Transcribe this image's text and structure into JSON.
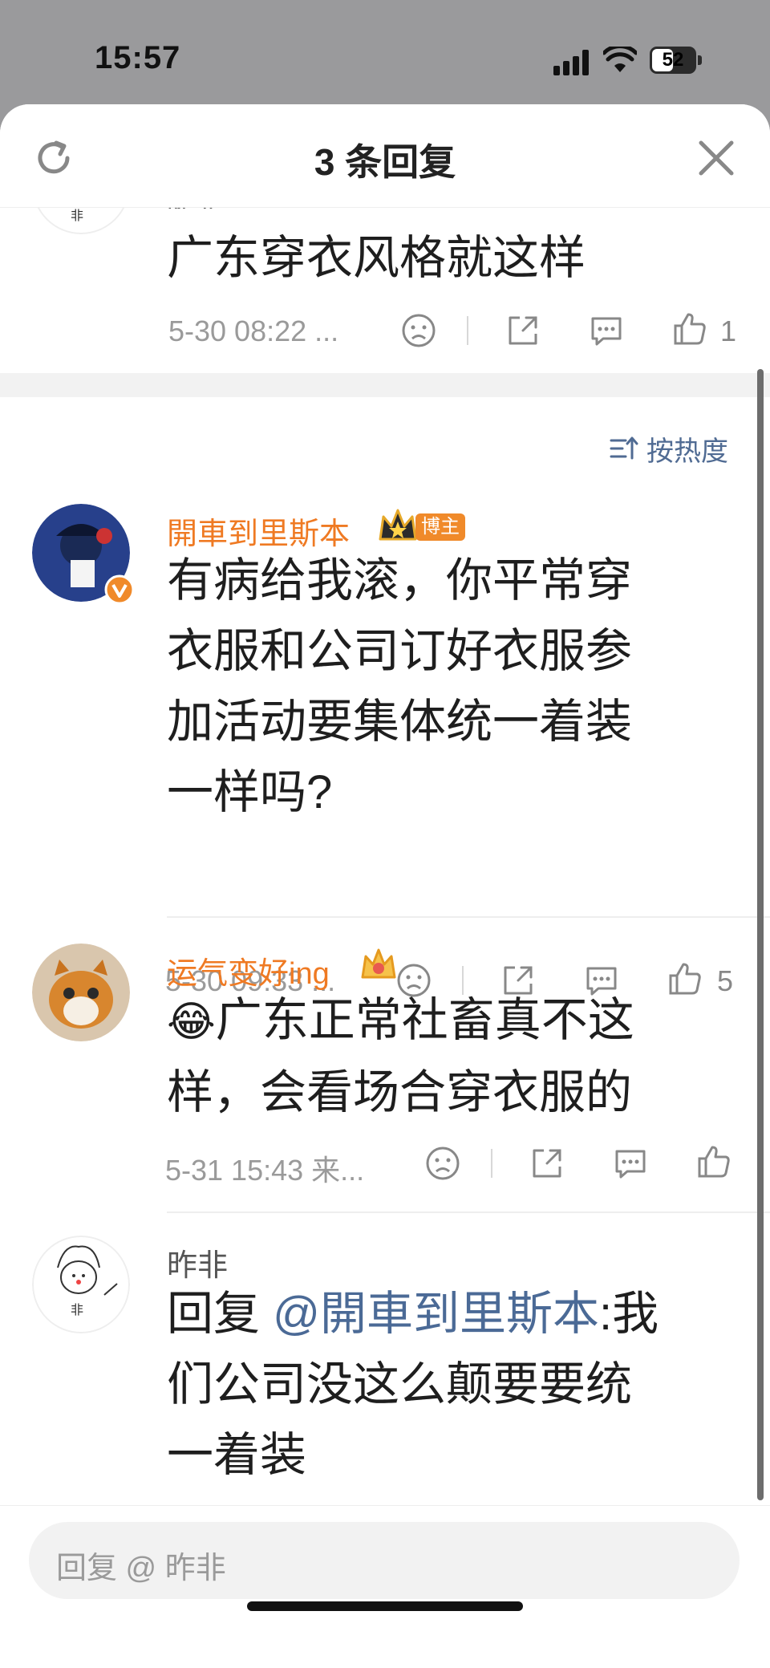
{
  "status": {
    "time": "15:57",
    "battery": "52"
  },
  "header": {
    "title": "3 条回复"
  },
  "parent_comment": {
    "username_partial": "昨非",
    "text": "广东穿衣风格就这样",
    "time": "5-30 08:22 ...",
    "likes": "1"
  },
  "sort": {
    "label": "按热度"
  },
  "replies": [
    {
      "username": "開車到里斯本",
      "badge": "博主",
      "text_lines": [
        "有病给我滚，你平常穿",
        "衣服和公司订好衣服参",
        "加活动要集体统一着装",
        "一样吗?"
      ],
      "time": "5-30 09:33 ...",
      "likes": "5"
    },
    {
      "username": "运气变好ing",
      "emoji": "😂",
      "text_lines": [
        "广东正常社畜真不这",
        "样，会看场合穿衣服的"
      ],
      "time": "5-31 15:43 来...",
      "likes": ""
    },
    {
      "username": "昨非",
      "reply_prefix": "回复",
      "mention": "@開車到里斯本",
      "text_first": ":我",
      "text_lines": [
        "们公司没这么颠要要统",
        "一着装"
      ]
    }
  ],
  "reply_bar": {
    "placeholder": "回复 @ 昨非"
  },
  "colors": {
    "username": "#ef7a23",
    "mention": "#4b6a96",
    "badge": "#f08a2a"
  }
}
